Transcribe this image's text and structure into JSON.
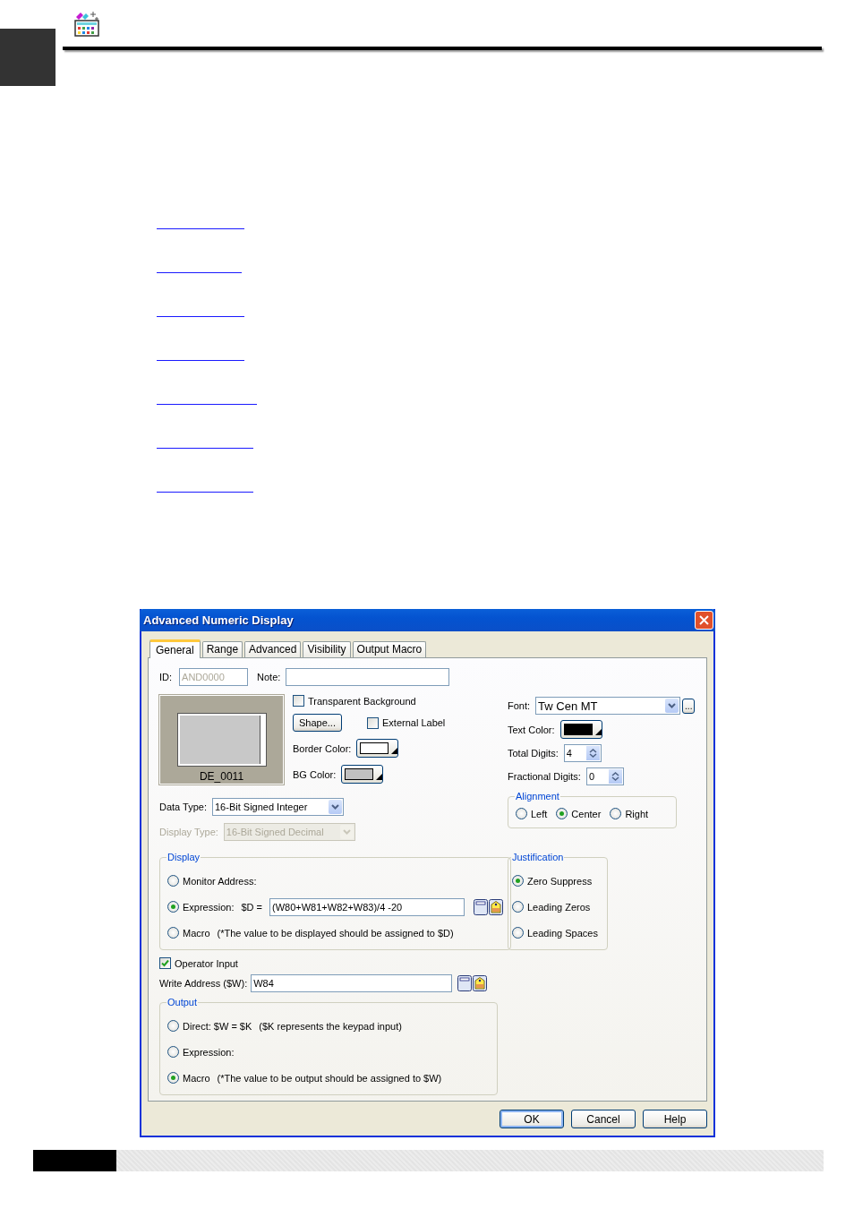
{
  "dialog": {
    "title": "Advanced Numeric Display",
    "tabs": [
      {
        "label": "General",
        "selected": true
      },
      {
        "label": "Range",
        "selected": false
      },
      {
        "label": "Advanced",
        "selected": false
      },
      {
        "label": "Visibility",
        "selected": false
      },
      {
        "label": "Output Macro",
        "selected": false
      }
    ],
    "id": {
      "label": "ID:",
      "value": "AND0000",
      "disabled": true
    },
    "note": {
      "label": "Note:"
    },
    "preview": {
      "caption": "DE_0011"
    },
    "transparent_background": {
      "label": "Transparent Background",
      "checked": false
    },
    "shape_button": "Shape...",
    "external_label": {
      "label": "External Label",
      "checked": false
    },
    "border_color": {
      "label": "Border Color:",
      "color": "#ffffff"
    },
    "bg_color": {
      "label": "BG Color:",
      "color": "#c0c0c0"
    },
    "font": {
      "label": "Font:",
      "value": "Tw Cen MT",
      "browse": "..."
    },
    "text_color": {
      "label": "Text Color:",
      "color": "#000000"
    },
    "total_digits": {
      "label": "Total Digits:",
      "value": "4"
    },
    "fractional_digits": {
      "label": "Fractional Digits:",
      "value": "0"
    },
    "data_type": {
      "label": "Data Type:",
      "value": "16-Bit Signed Integer",
      "disabled": false
    },
    "display_type": {
      "label": "Display Type:",
      "value": "16-Bit Signed Decimal",
      "disabled": true
    },
    "alignment": {
      "title": "Alignment",
      "options": [
        {
          "label": "Left",
          "selected": false
        },
        {
          "label": "Center",
          "selected": true
        },
        {
          "label": "Right",
          "selected": false
        }
      ]
    },
    "display": {
      "title": "Display",
      "options": [
        {
          "kind": "plain",
          "label": "Monitor Address:",
          "selected": false
        },
        {
          "kind": "field",
          "label": "Expression:",
          "prefix": "$D =",
          "value": "(W80+W81+W82+W83)/4 -20",
          "selected": true
        },
        {
          "kind": "note",
          "label": "Macro",
          "note": "(*The value to be displayed should be assigned to $D)",
          "selected": false
        }
      ]
    },
    "justification": {
      "title": "Justification",
      "options": [
        {
          "label": "Zero Suppress",
          "selected": true
        },
        {
          "label": "Leading Zeros",
          "selected": false
        },
        {
          "label": "Leading Spaces",
          "selected": false
        }
      ]
    },
    "operator_input": {
      "label": "Operator Input",
      "checked": true
    },
    "write_address": {
      "label": "Write Address ($W):",
      "value": "W84"
    },
    "output": {
      "title": "Output",
      "options": [
        {
          "kind": "note",
          "label": "Direct: $W = $K",
          "note": "($K represents the keypad input)",
          "selected": false
        },
        {
          "kind": "plain",
          "label": "Expression:",
          "selected": false
        },
        {
          "kind": "note",
          "label": "Macro",
          "note": "(*The value to be output should be assigned to $W)",
          "selected": true
        }
      ]
    },
    "buttons": [
      {
        "label": "OK",
        "default": true
      },
      {
        "label": "Cancel",
        "default": false
      },
      {
        "label": "Help",
        "default": false
      }
    ]
  }
}
